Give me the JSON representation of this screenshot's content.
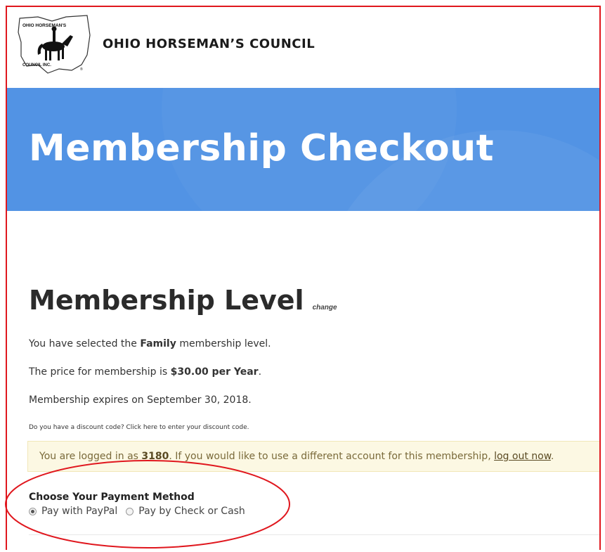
{
  "header": {
    "logo_text_top": "OHIO HORSEMAN'S",
    "logo_text_bottom": "COUNCIL INC.",
    "site_title": "OHIO HORSEMAN’S COUNCIL"
  },
  "hero": {
    "title": "Membership Checkout"
  },
  "level": {
    "heading": "Membership Level",
    "change_link": "change",
    "selected_prefix": "You have selected the ",
    "selected_level": "Family",
    "selected_suffix": " membership level.",
    "price_prefix": "The price for membership is ",
    "price": "$30.00 per Year",
    "price_suffix": ".",
    "expires": "Membership expires on September 30, 2018.",
    "discount": "Do you have a discount code? Click here to enter your discount code."
  },
  "notice": {
    "prefix": "You are logged in as ",
    "user": "3180",
    "middle": ". If you would like to use a different account for this membership, ",
    "link": "log out now",
    "suffix": "."
  },
  "payment": {
    "title": "Choose Your Payment Method",
    "options": [
      {
        "label": "Pay with PayPal",
        "checked": true
      },
      {
        "label": "Pay by Check or Cash",
        "checked": false
      }
    ]
  },
  "colors": {
    "hero_bg": "#5293e4",
    "frame_border": "#e0171e",
    "notice_bg": "#fcf8e3"
  }
}
